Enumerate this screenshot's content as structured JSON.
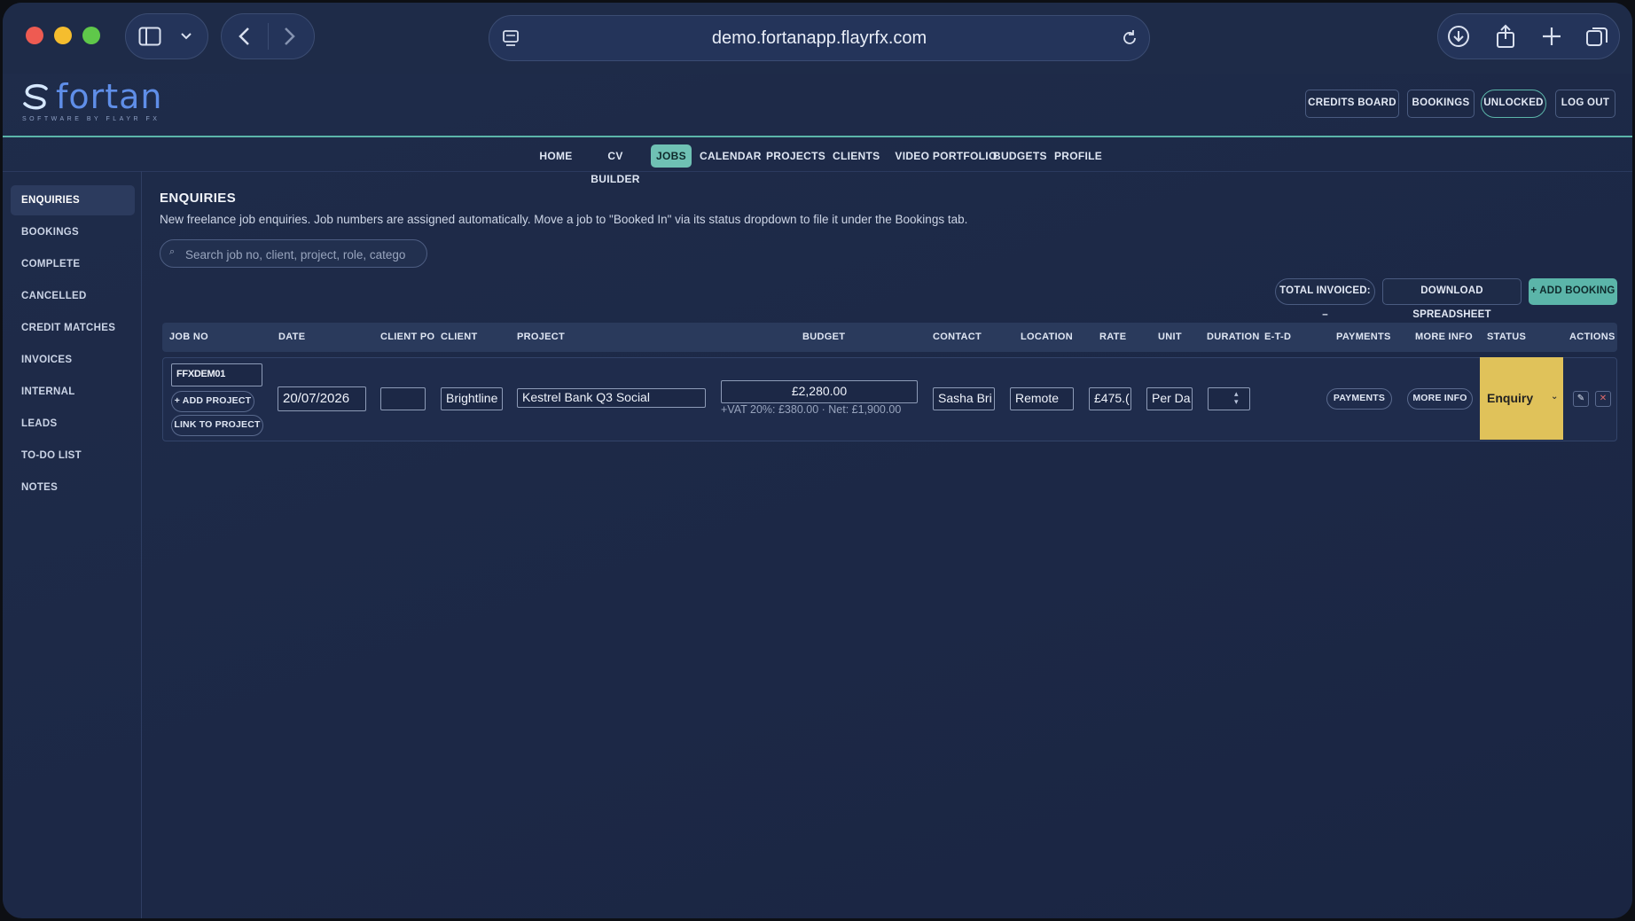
{
  "browser": {
    "url": "demo.fortanapp.flayrfx.com"
  },
  "brand": {
    "name": "fortan",
    "tagline": "SOFTWARE BY FLAYR FX",
    "accent": "#5bb5a9",
    "status_color": "#e0c25a"
  },
  "header_buttons": {
    "credits_board": "CREDITS BOARD",
    "bookings": "BOOKINGS",
    "unlocked": "UNLOCKED",
    "logout": "LOG OUT"
  },
  "nav": {
    "home": "HOME",
    "cv_builder": "CV BUILDER",
    "jobs": "JOBS",
    "calendar": "CALENDAR",
    "projects": "PROJECTS",
    "clients": "CLIENTS",
    "video_portfolio": "VIDEO PORTFOLIO",
    "budgets": "BUDGETS",
    "profile": "PROFILE"
  },
  "sidebar": {
    "enquiries": "ENQUIRIES",
    "bookings": "BOOKINGS",
    "complete": "COMPLETE",
    "cancelled": "CANCELLED",
    "credit_matches": "CREDIT MATCHES",
    "invoices": "INVOICES",
    "internal": "INTERNAL",
    "leads": "LEADS",
    "todo": "TO-DO LIST",
    "notes": "NOTES"
  },
  "main": {
    "title": "ENQUIRIES",
    "description": "New freelance job enquiries. Job numbers are assigned automatically. Move a job to \"Booked In\" via its status dropdown to file it under the Bookings tab.",
    "search_placeholder": "Search job no, client, project, role, catego"
  },
  "toolbar": {
    "total_invoiced": "TOTAL INVOICED: –",
    "download": "DOWNLOAD SPREADSHEET",
    "add_booking": "+ ADD BOOKING"
  },
  "table": {
    "columns": {
      "job_no": "JOB NO",
      "date": "DATE",
      "client_po": "CLIENT PO",
      "client": "CLIENT",
      "project": "PROJECT",
      "budget": "BUDGET",
      "contact": "CONTACT",
      "location": "LOCATION",
      "rate": "RATE",
      "unit": "UNIT",
      "duration": "DURATION",
      "etd": "E-T-D",
      "payments": "PAYMENTS",
      "more_info": "MORE INFO",
      "status": "STATUS",
      "actions": "ACTIONS"
    },
    "row": {
      "job_no": "FFXDEM01",
      "add_project": "+ ADD PROJECT",
      "link_project": "LINK TO PROJECT",
      "date": "20/07/2026",
      "client_po": "",
      "client": "Brightline",
      "project": "Kestrel Bank Q3 Social",
      "budget": "£2,280.00",
      "vat_note": "+VAT 20%: £380.00 · Net: £1,900.00",
      "contact": "Sasha Bri",
      "location": "Remote",
      "rate": "£475.(",
      "unit": "Per Da",
      "duration": "",
      "payments": "PAYMENTS",
      "more_info": "MORE INFO",
      "status": "Enquiry"
    }
  }
}
